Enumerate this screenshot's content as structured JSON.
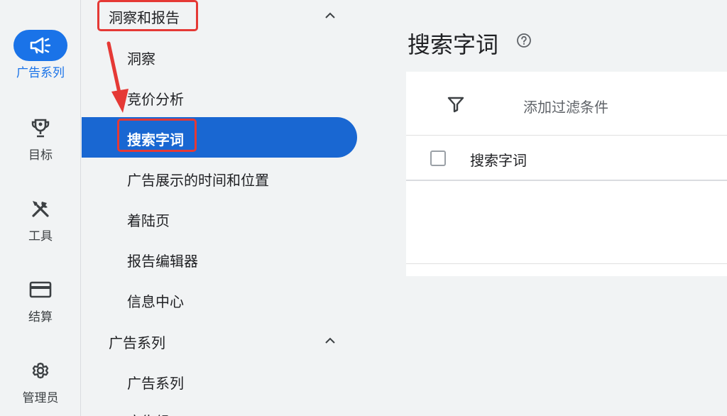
{
  "rail": [
    {
      "label": "广告系列",
      "icon": "megaphone-icon",
      "active": true
    },
    {
      "label": "目标",
      "icon": "trophy-icon",
      "active": false
    },
    {
      "label": "工具",
      "icon": "tools-icon",
      "active": false
    },
    {
      "label": "结算",
      "icon": "credit-card-icon",
      "active": false
    },
    {
      "label": "管理员",
      "icon": "gear-icon",
      "active": false
    }
  ],
  "nav": {
    "section1": {
      "label": "洞察和报告",
      "expanded": true
    },
    "section1_items": [
      {
        "label": "洞察"
      },
      {
        "label": "竞价分析"
      },
      {
        "label": "搜索字词",
        "active": true
      },
      {
        "label": "广告展示的时间和位置"
      },
      {
        "label": "着陆页"
      },
      {
        "label": "报告编辑器"
      },
      {
        "label": "信息中心"
      }
    ],
    "section2": {
      "label": "广告系列",
      "expanded": true
    },
    "section2_items": [
      {
        "label": "广告系列"
      },
      {
        "label": "广告组"
      }
    ]
  },
  "main": {
    "title": "搜索字词",
    "filter_label": "添加过滤条件",
    "column_header": "搜索字词"
  },
  "colors": {
    "accent": "#1a73e8",
    "active_nav": "#1967d2",
    "annotation": "#e53935"
  }
}
